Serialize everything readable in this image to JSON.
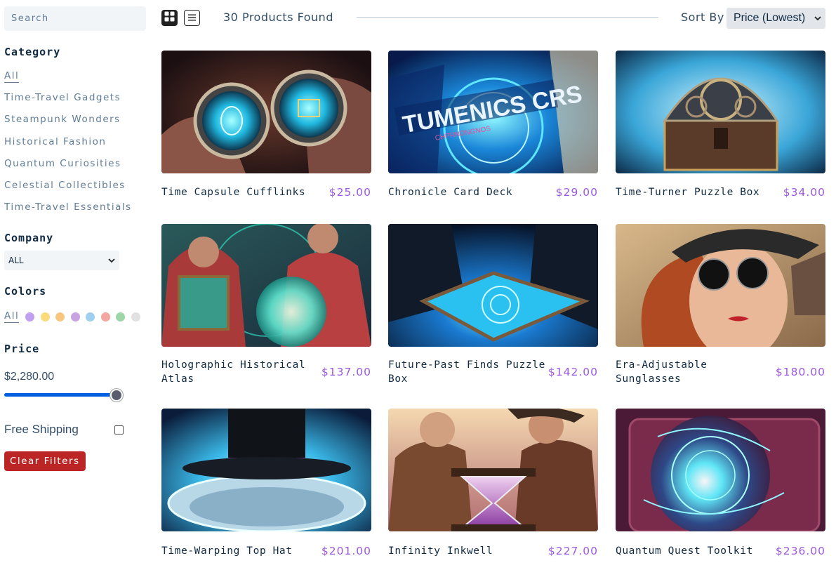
{
  "sidebar": {
    "search_placeholder": "Search",
    "category_title": "Category",
    "categories": [
      "All",
      "Time-Travel Gadgets",
      "Steampunk Wonders",
      "Historical Fashion",
      "Quantum Curiosities",
      "Celestial Collectibles",
      "Time-Travel Essentials"
    ],
    "company_title": "Company",
    "company_value": "ALL",
    "colors_title": "Colors",
    "colors_all": "All",
    "colors": [
      "#c0a0ee",
      "#fbdb7c",
      "#f8c77f",
      "#c9a3e0",
      "#9fd0ef",
      "#f2a7a0",
      "#9ed5a9",
      "#e1e1e1"
    ],
    "price_title": "Price",
    "price_value": "$2,280.00",
    "price_fraction": 1.0,
    "shipping_label": "Free Shipping",
    "shipping_checked": false,
    "clear_label": "Clear Filters"
  },
  "topbar": {
    "found_text": "30 Products Found",
    "sort_label": "Sort By",
    "sort_value": "Price (Lowest)"
  },
  "products": [
    {
      "name": "Time Capsule Cufflinks",
      "price": "$25.00"
    },
    {
      "name": "Chronicle Card Deck",
      "price": "$29.00",
      "image_text": "TUMENICS CRS",
      "image_subtext": "CHPRNONGNOS"
    },
    {
      "name": "Time-Turner Puzzle Box",
      "price": "$34.00"
    },
    {
      "name": "Holographic Historical Atlas",
      "price": "$137.00"
    },
    {
      "name": "Future-Past Finds Puzzle Box",
      "price": "$142.00"
    },
    {
      "name": "Era-Adjustable Sunglasses",
      "price": "$180.00"
    },
    {
      "name": "Time-Warping Top Hat",
      "price": "$201.00"
    },
    {
      "name": "Infinity Inkwell",
      "price": "$227.00"
    },
    {
      "name": "Quantum Quest Toolkit",
      "price": "$236.00"
    }
  ],
  "colors": {
    "accent_price": "#9d59e3",
    "clear_button": "#bb2525",
    "slider": "#0060df"
  }
}
